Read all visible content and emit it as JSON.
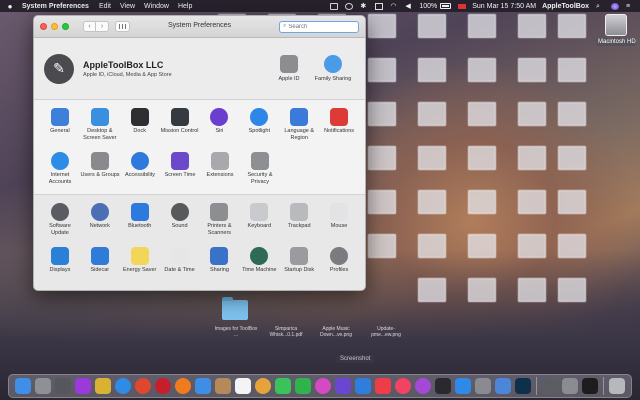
{
  "menubar": {
    "app_name": "System Preferences",
    "menus": [
      "Edit",
      "View",
      "Window",
      "Help"
    ],
    "battery_percent": "100%",
    "datetime": "Sun Mar 15  7:50 AM",
    "user": "AppleToolBox"
  },
  "desktop": {
    "hd_label": "Macintosh HD",
    "folder_caption": "Images for ToolBox ...",
    "captions": [
      "Simparica Whisk...0.1.pdf",
      "Apple Music Down...ve.png",
      "Update-pme...ew.png"
    ],
    "screenshot_label": "Screenshot"
  },
  "window": {
    "title": "System Preferences",
    "search_placeholder": "Search",
    "account": {
      "name": "AppleToolBox LLC",
      "subtitle": "Apple ID, iCloud, Media & App Store",
      "apple_id_label": "Apple ID",
      "family_label": "Family Sharing"
    },
    "panes_top_row1": [
      {
        "label": "General",
        "icon": "general-icon",
        "color": "#3d7fd9"
      },
      {
        "label": "Desktop & Screen Saver",
        "icon": "desktop-icon",
        "color": "#3a8fe0"
      },
      {
        "label": "Dock",
        "icon": "dock-icon",
        "color": "#2f2f33"
      },
      {
        "label": "Mission Control",
        "icon": "mission-control-icon",
        "color": "#353a40"
      },
      {
        "label": "Siri",
        "icon": "siri-icon",
        "color": "#6a3fd0"
      },
      {
        "label": "Spotlight",
        "icon": "spotlight-icon",
        "color": "#2e86e8"
      },
      {
        "label": "Language & Region",
        "icon": "language-icon",
        "color": "#3a7ad8"
      },
      {
        "label": "Notifications",
        "icon": "notifications-icon",
        "color": "#dd3b35"
      }
    ],
    "panes_top_row2": [
      {
        "label": "Internet Accounts",
        "icon": "at-icon",
        "color": "#2b8de6"
      },
      {
        "label": "Users & Groups",
        "icon": "users-icon",
        "color": "#8a8a8e"
      },
      {
        "label": "Accessibility",
        "icon": "accessibility-icon",
        "color": "#2f79dc"
      },
      {
        "label": "Screen Time",
        "icon": "hourglass-icon",
        "color": "#6c49c8"
      },
      {
        "label": "Extensions",
        "icon": "puzzle-icon",
        "color": "#a7a9ad"
      },
      {
        "label": "Security & Privacy",
        "icon": "house-lock-icon",
        "color": "#8e8f93"
      }
    ],
    "panes_bottom_row1": [
      {
        "label": "Software Update",
        "icon": "gear-update-icon",
        "color": "#5a5c61"
      },
      {
        "label": "Network",
        "icon": "globe-icon",
        "color": "#4a6fb5"
      },
      {
        "label": "Bluetooth",
        "icon": "bluetooth-icon",
        "color": "#2c7ae0"
      },
      {
        "label": "Sound",
        "icon": "speaker-icon",
        "color": "#58595d"
      },
      {
        "label": "Printers & Scanners",
        "icon": "printer-icon",
        "color": "#8d8e92"
      },
      {
        "label": "Keyboard",
        "icon": "keyboard-icon",
        "color": "#c9cacd"
      },
      {
        "label": "Trackpad",
        "icon": "trackpad-icon",
        "color": "#b9babd"
      },
      {
        "label": "Mouse",
        "icon": "mouse-icon",
        "color": "#e3e3e5"
      }
    ],
    "panes_bottom_row2": [
      {
        "label": "Displays",
        "icon": "display-icon",
        "color": "#2a7fd6"
      },
      {
        "label": "Sidecar",
        "icon": "sidecar-icon",
        "color": "#2f7bd8"
      },
      {
        "label": "Energy Saver",
        "icon": "bulb-icon",
        "color": "#f1d65a"
      },
      {
        "label": "Date & Time",
        "icon": "clock-icon",
        "color": "#e6e6e8"
      },
      {
        "label": "Sharing",
        "icon": "sharing-icon",
        "color": "#3a72c8"
      },
      {
        "label": "Time Machine",
        "icon": "time-machine-icon",
        "color": "#2f6a55"
      },
      {
        "label": "Startup Disk",
        "icon": "disk-icon",
        "color": "#9a9b9f"
      },
      {
        "label": "Profiles",
        "icon": "checkmark-icon",
        "color": "#7b7c80"
      }
    ]
  },
  "dock": [
    {
      "name": "finder-icon",
      "color": "#3f8fe8"
    },
    {
      "name": "launchpad-icon",
      "color": "#8f9096"
    },
    {
      "name": "rocket-icon",
      "color": "#55575c"
    },
    {
      "name": "podcast-icon",
      "color": "#9a3ad8"
    },
    {
      "name": "photo-icon",
      "color": "#d9b233"
    },
    {
      "name": "safari-icon",
      "color": "#2e8be6"
    },
    {
      "name": "chrome-icon",
      "color": "#e0472f"
    },
    {
      "name": "opera-icon",
      "color": "#c61f2b"
    },
    {
      "name": "firefox-icon",
      "color": "#f07a1e"
    },
    {
      "name": "mail-icon",
      "color": "#3f8ee6"
    },
    {
      "name": "contacts-icon",
      "color": "#b58a5a"
    },
    {
      "name": "calendar-icon",
      "color": "#f4f4f4"
    },
    {
      "name": "photos-icon",
      "color": "#e6a23b"
    },
    {
      "name": "messages-icon",
      "color": "#3bc25a"
    },
    {
      "name": "facetime-icon",
      "color": "#2fb34c"
    },
    {
      "name": "itunes-icon",
      "color": "#d44ac4"
    },
    {
      "name": "imovie-icon",
      "color": "#6a47d0"
    },
    {
      "name": "keynote-icon",
      "color": "#2f7ddc"
    },
    {
      "name": "news-icon",
      "color": "#ef3c4a"
    },
    {
      "name": "music-icon",
      "color": "#f24365"
    },
    {
      "name": "podcasts-icon",
      "color": "#a349d6"
    },
    {
      "name": "tv-icon",
      "color": "#2a2a2e"
    },
    {
      "name": "appstore-icon",
      "color": "#2e8ae6"
    },
    {
      "name": "system-preferences-icon",
      "color": "#8a8b90"
    },
    {
      "name": "preview-icon",
      "color": "#4c86d9"
    },
    {
      "name": "photoshop-icon",
      "color": "#0f2f4a"
    },
    {
      "name": "utility-icon",
      "color": "#5b5d62"
    },
    {
      "name": "keychain-icon",
      "color": "#8b8c91"
    },
    {
      "name": "terminal-icon",
      "color": "#1d1d1f"
    },
    {
      "name": "trash-icon",
      "color": "#b7b8bc"
    }
  ]
}
